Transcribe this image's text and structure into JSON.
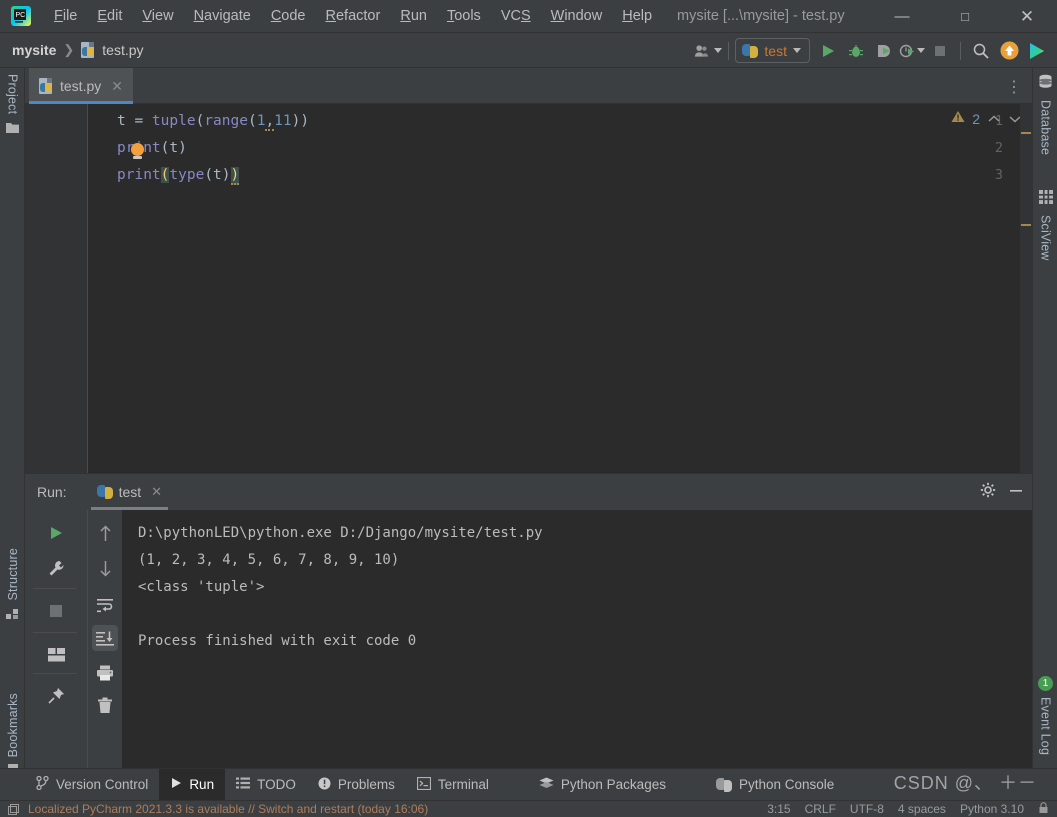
{
  "window": {
    "title": "mysite [...\\mysite] - test.py",
    "minimize": "—",
    "maximize": "□",
    "close": "✕"
  },
  "menu": [
    {
      "label": "File",
      "mnemonic": "F"
    },
    {
      "label": "Edit",
      "mnemonic": "E"
    },
    {
      "label": "View",
      "mnemonic": "V"
    },
    {
      "label": "Navigate",
      "mnemonic": "N"
    },
    {
      "label": "Code",
      "mnemonic": "C"
    },
    {
      "label": "Refactor",
      "mnemonic": "R"
    },
    {
      "label": "Run",
      "mnemonic": "R"
    },
    {
      "label": "Tools",
      "mnemonic": "T"
    },
    {
      "label": "VCS",
      "mnemonic": "S"
    },
    {
      "label": "Window",
      "mnemonic": "W"
    },
    {
      "label": "Help",
      "mnemonic": "H"
    }
  ],
  "navbar": {
    "breadcrumb": [
      "mysite",
      "test.py"
    ],
    "separator": "❯",
    "run_config": "test",
    "icons": [
      "user-avatar-icon",
      "run-icon",
      "debug-icon",
      "coverage-icon",
      "profile-icon",
      "stop-icon",
      "search-icon",
      "update-icon",
      "gradient-icon"
    ]
  },
  "editor": {
    "tab": {
      "label": "test.py",
      "close": "✕"
    },
    "overflow_menu": "⋮",
    "warning_count": "2",
    "chevron_up": "⌃",
    "chevron_down": "⌄",
    "lines": [
      {
        "no": "1",
        "text": "t = tuple(range(1,11))"
      },
      {
        "no": "2",
        "text": "print(t)"
      },
      {
        "no": "3",
        "text": "print(type(t))"
      }
    ],
    "tokens": {
      "l1_a": "t = ",
      "l1_tuple": "tuple",
      "l1_p1": "(",
      "l1_range": "range",
      "l1_p2": "(",
      "l1_one": "1",
      "l1_comma": ",",
      "l1_eleven": "11",
      "l1_close": "))",
      "l2_print": "print",
      "l2_args": "(t)",
      "l3_print": "print",
      "l3_open": "(",
      "l3_type": "type",
      "l3_inner": "(t)",
      "l3_close": ")"
    }
  },
  "left_strip": [
    {
      "label": "Project",
      "icon": "folder-icon"
    },
    {
      "label": "Structure",
      "icon": "structure-icon"
    },
    {
      "label": "Bookmarks",
      "icon": "bookmark-icon"
    }
  ],
  "right_strip": [
    {
      "label": "Database",
      "icon": "database-icon"
    },
    {
      "label": "SciView",
      "icon": "grid-icon"
    },
    {
      "label": "Event Log",
      "icon": "event-log-icon",
      "badge": "1"
    }
  ],
  "run_panel": {
    "title": "Run:",
    "tab_label": "test",
    "tab_close": "✕",
    "settings_icon": "gear-icon",
    "minimize_icon": "minimize-icon",
    "left_tools": [
      "rerun-icon",
      "wrench-icon",
      "stop-icon",
      "layout-icon",
      "pin-icon"
    ],
    "mid_tools": [
      "arrow-up-icon",
      "arrow-down-icon",
      "soft-wrap-icon",
      "scroll-to-end-icon",
      "print-icon",
      "trash-icon"
    ],
    "console": [
      "D:\\pythonLED\\python.exe D:/Django/mysite/test.py",
      "(1, 2, 3, 4, 5, 6, 7, 8, 9, 10)",
      "<class 'tuple'>",
      "",
      "Process finished with exit code 0"
    ]
  },
  "bottom_tabs": [
    {
      "label": "Version Control",
      "icon": "branch-icon",
      "active": false
    },
    {
      "label": "Run",
      "icon": "play-icon",
      "active": true
    },
    {
      "label": "TODO",
      "icon": "list-icon",
      "active": false
    },
    {
      "label": "Problems",
      "icon": "exclamation-icon",
      "active": false
    },
    {
      "label": "Terminal",
      "icon": "terminal-icon",
      "active": false
    },
    {
      "label": "Python Packages",
      "icon": "packages-icon",
      "active": false
    },
    {
      "label": "Python Console",
      "icon": "python-icon",
      "active": false
    }
  ],
  "status_bar": {
    "message": "Localized PyCharm 2021.3.3 is available // Switch and restart (today 16:06)",
    "caret": "3:15",
    "line_sep": "CRLF",
    "encoding": "UTF-8",
    "indent": "4 spaces",
    "interpreter": "Python 3.10"
  },
  "watermark": "CSDN @、",
  "colors": {
    "bg": "#3c3f41",
    "editor_bg": "#2b2b2b",
    "accent_blue": "#4a88c7",
    "run_orange": "#cc7832",
    "builtin_violet": "#8888c6",
    "number_blue": "#6897bb",
    "bracket_yellow": "#ffc66d",
    "green": "#499c54",
    "warning": "#a5894a"
  }
}
